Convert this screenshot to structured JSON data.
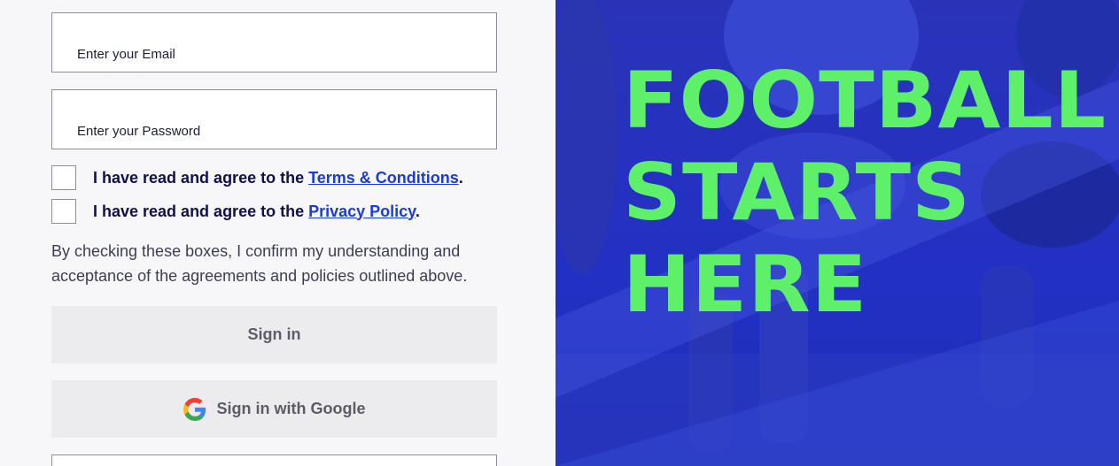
{
  "form": {
    "email_placeholder": "Enter your Email",
    "password_placeholder": "Enter your Password",
    "terms": {
      "prefix": "I have read and agree to the ",
      "link": "Terms & Conditions",
      "suffix": "."
    },
    "privacy": {
      "prefix": "I have read and agree to the ",
      "link": "Privacy Policy",
      "suffix": "."
    },
    "confirm_text": "By checking these boxes, I confirm my understanding and acceptance of the agreements and policies outlined above.",
    "signin_label": "Sign in",
    "google_label": "Sign in with Google",
    "google_icon": "google-g-icon"
  },
  "hero": {
    "line1": "FOOTBALL",
    "line2": "STARTS",
    "line3": "HERE",
    "headline_color": "#5ff06a",
    "overlay_color": "#2430c8"
  }
}
